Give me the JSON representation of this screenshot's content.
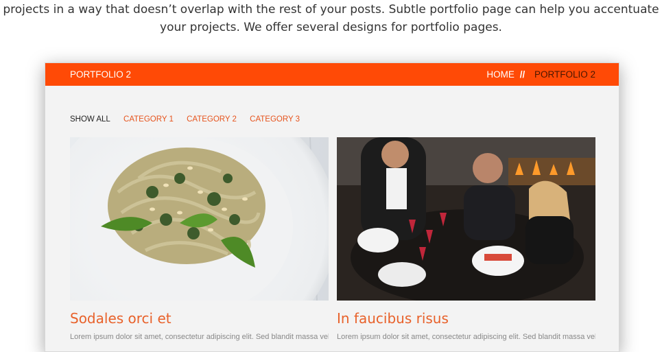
{
  "intro": {
    "line1": "projects in a way that doesn’t overlap with the rest of your posts. Subtle portfolio page can help you accentuate",
    "line2": "your projects. We offer several designs for portfolio pages."
  },
  "header": {
    "title": "PORTFOLIO 2",
    "home": "HOME",
    "separator": "//",
    "current": "PORTFOLIO 2"
  },
  "filters": [
    "SHOW ALL",
    "CATEGORY 1",
    "CATEGORY 2",
    "CATEGORY 3"
  ],
  "cards": [
    {
      "title": "Sodales orci et",
      "text": "Lorem ipsum dolor sit amet, consectetur adipiscing elit. Sed blandit massa vel"
    },
    {
      "title": "In faucibus risus",
      "text": "Lorem ipsum dolor sit amet, consectetur adipiscing elit. Sed blandit massa vel"
    }
  ],
  "colors": {
    "accent": "#ff4a06",
    "link": "#e6531c"
  }
}
